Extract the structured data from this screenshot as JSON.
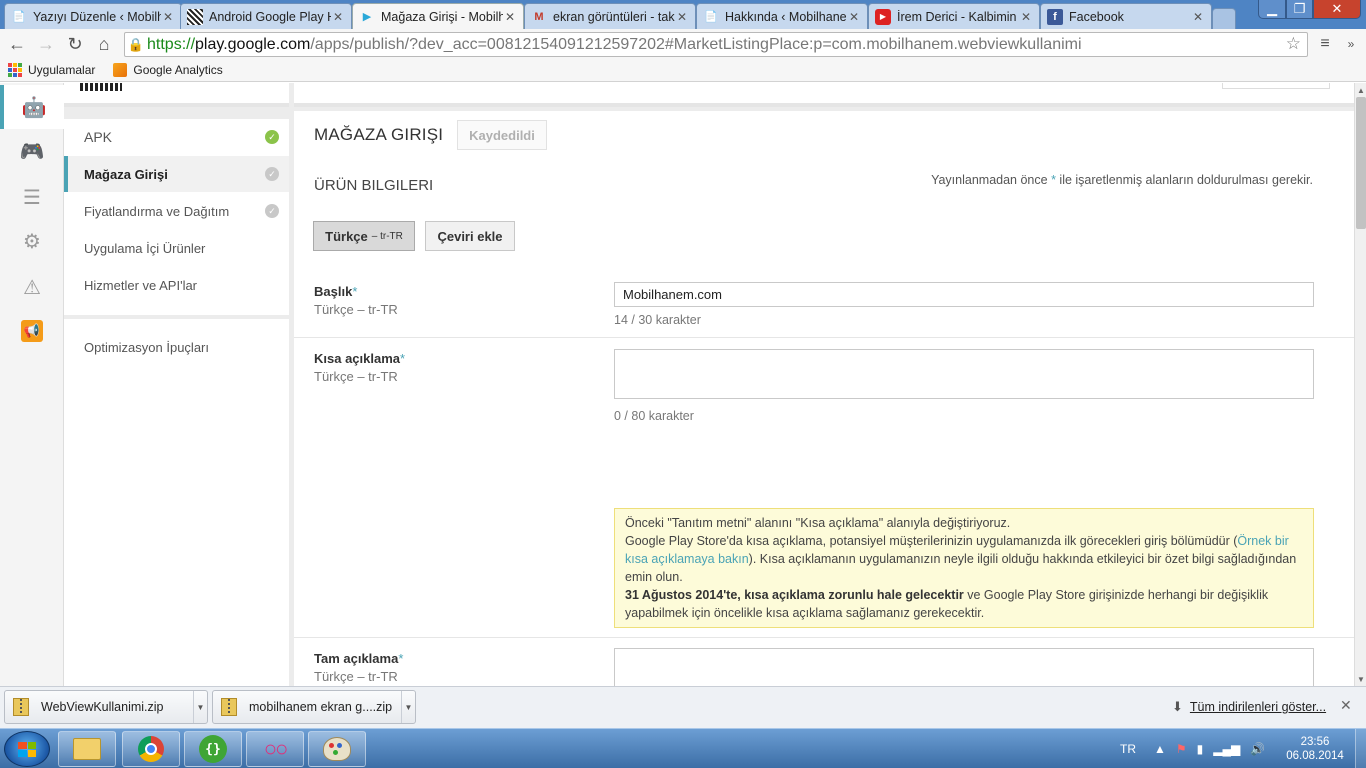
{
  "browser": {
    "tabs": [
      {
        "title": "Yazıyı Düzenle ‹ Mobilhanem",
        "icon": "wordpress-icon"
      },
      {
        "title": "Android Google Play Hizmetleri",
        "icon": "qr-icon"
      },
      {
        "title": "Mağaza Girişi - Mobilhanem",
        "icon": "google-play-icon",
        "active": true
      },
      {
        "title": "ekran görüntüleri - tak",
        "icon": "gmail-icon"
      },
      {
        "title": "Hakkında ‹ Mobilhanem",
        "icon": "page-icon"
      },
      {
        "title": "İrem Derici - Kalbimin",
        "icon": "youtube-icon"
      },
      {
        "title": "Facebook",
        "icon": "facebook-icon"
      }
    ],
    "url": {
      "scheme": "https://",
      "host": "play.google.com",
      "path": "/apps/publish/?dev_acc=00812154091212597202#MarketListingPlace:p=com.mobilhanem.webviewkullanimi"
    },
    "bookmarks": [
      {
        "label": "Uygulamalar",
        "icon": "apps-grid-icon"
      },
      {
        "label": "Google Analytics",
        "icon": "analytics-icon"
      }
    ]
  },
  "leftrail": {
    "icons": [
      "android-icon",
      "gamepad-icon",
      "database-icon",
      "settings-gear-icon",
      "warning-icon",
      "megaphone-icon"
    ]
  },
  "menu": {
    "items": [
      {
        "label": "APK",
        "status": "complete"
      },
      {
        "label": "Mağaza Girişi",
        "status": "pending",
        "selected": true
      },
      {
        "label": "Fiyatlandırma ve Dağıtım",
        "status": "pending"
      },
      {
        "label": "Uygulama İçi Ürünler"
      },
      {
        "label": "Hizmetler ve API'lar"
      }
    ],
    "tips": "Optimizasyon İpuçları"
  },
  "main": {
    "title": "MAĞAZA GIRIŞI",
    "saved_label": "Kaydedildi",
    "section_title": "ÜRÜN BILGILERI",
    "required_note_before": "Yayınlanmadan önce ",
    "required_note_star": "*",
    "required_note_after": " ile işaretlenmiş alanların doldurulması gerekir.",
    "lang_button": "Türkçe",
    "lang_button_code": "– tr-TR",
    "add_translation": "Çeviri ekle",
    "fields": {
      "title": {
        "label": "Başlık",
        "star": "*",
        "lang": "Türkçe – tr-TR",
        "value": "Mobilhanem.com",
        "counter": "14 / 30 karakter"
      },
      "short": {
        "label": "Kısa açıklama",
        "star": "*",
        "lang": "Türkçe – tr-TR",
        "value": "",
        "counter": "0 / 80 karakter"
      },
      "full": {
        "label": "Tam açıklama",
        "star": "*",
        "lang": "Türkçe – tr-TR",
        "value": ""
      }
    },
    "notice": {
      "line1": "Önceki \"Tanıtım metni\" alanını \"Kısa açıklama\" alanıyla değiştiriyoruz.",
      "line2_a": "Google Play Store'da kısa açıklama, potansiyel müşterilerinizin uygulamanızda ilk görecekleri giriş bölümüdür (",
      "line2_link": "Örnek bir kısa açıklamaya bakın",
      "line2_b": "). Kısa açıklamanın uygulamanızın neyle ilgili olduğu hakkında etkileyici bir özet bilgi sağladığından emin olun.",
      "line3_bold": "31 Ağustos 2014'te, kısa açıklama zorunlu hale gelecektir",
      "line3_rest": " ve Google Play Store girişinizde herhangi bir değişiklik yapabilmek için öncelikle kısa açıklama sağlamanız gerekecektir."
    }
  },
  "downloads": {
    "items": [
      "WebViewKullanimi.zip",
      "mobilhanem ekran g....zip"
    ],
    "show_all": "Tüm indirilenleri göster..."
  },
  "taskbar": {
    "lang": "TR",
    "time": "23:56",
    "date": "06.08.2014"
  }
}
